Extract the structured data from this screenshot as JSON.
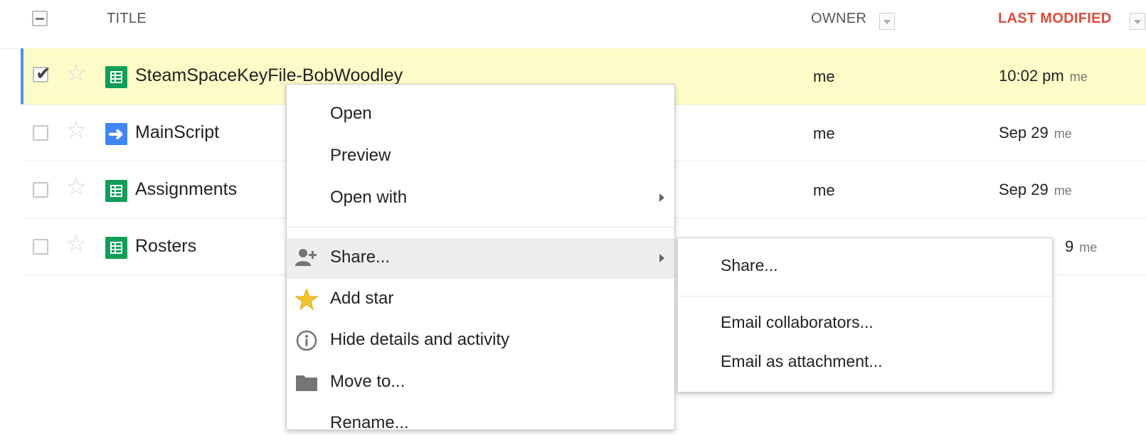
{
  "header": {
    "title_label": "TITLE",
    "owner_label": "OWNER",
    "modified_label": "LAST MODIFIED",
    "accent_color": "#dd4b39"
  },
  "rows": [
    {
      "name": "SteamSpaceKeyFile-BobWoodley",
      "icon": "sheets-icon",
      "owner": "me",
      "modified": "10:02 pm",
      "modified_by": "me",
      "selected": true
    },
    {
      "name": "MainScript",
      "icon": "script-icon",
      "owner": "me",
      "modified": "Sep 29",
      "modified_by": "me",
      "selected": false
    },
    {
      "name": "Assignments",
      "icon": "sheets-icon",
      "owner": "me",
      "modified": "Sep 29",
      "modified_by": "me",
      "selected": false
    },
    {
      "name": "Rosters",
      "icon": "sheets-icon",
      "owner": "",
      "modified": "9",
      "modified_by": "me",
      "selected": false
    }
  ],
  "context_menu": {
    "items": [
      {
        "label": "Open",
        "icon": ""
      },
      {
        "label": "Preview",
        "icon": ""
      },
      {
        "label": "Open with",
        "icon": "",
        "submenu": true
      },
      {
        "label": "Share...",
        "icon": "add-person-icon",
        "submenu": true,
        "highlighted": true
      },
      {
        "label": "Add star",
        "icon": "star-icon"
      },
      {
        "label": "Hide details and activity",
        "icon": "info-icon"
      },
      {
        "label": "Move to...",
        "icon": "folder-icon"
      },
      {
        "label": "Rename...",
        "icon": ""
      }
    ]
  },
  "share_submenu": {
    "items": [
      "Share...",
      "Email collaborators...",
      "Email as attachment..."
    ]
  },
  "colors": {
    "selected_row_bg": "#fdfcc8",
    "selected_row_border": "#4d90fe",
    "sheets_green": "#0f9d58",
    "script_blue": "#4285f4",
    "star_gold": "#f4c430"
  }
}
